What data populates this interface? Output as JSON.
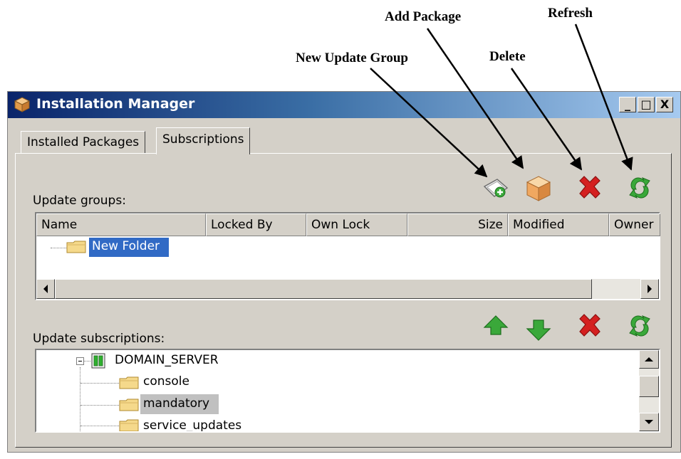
{
  "annotations": {
    "add_package": "Add Package",
    "refresh": "Refresh",
    "new_update_group": "New Update Group",
    "delete": "Delete"
  },
  "window": {
    "title": "Installation Manager",
    "controls": {
      "minimize": "_",
      "maximize": "□",
      "close": "X"
    }
  },
  "tabs": [
    {
      "label": "Installed Packages",
      "active": false
    },
    {
      "label": "Subscriptions",
      "active": true
    }
  ],
  "update_groups": {
    "label": "Update groups:",
    "toolbar": [
      "new-update-group-icon",
      "add-package-icon",
      "delete-icon",
      "refresh-icon"
    ],
    "columns": [
      "Name",
      "Locked By",
      "Own Lock",
      "Size",
      "Modified",
      "Owner"
    ],
    "rows": [
      {
        "name": "New Folder",
        "selected": true
      }
    ]
  },
  "update_subscriptions": {
    "label": "Update subscriptions:",
    "toolbar": [
      "move-up-icon",
      "move-down-icon",
      "delete-icon",
      "refresh-icon"
    ],
    "tree": {
      "root": "DOMAIN_SERVER",
      "children": [
        "console",
        "mandatory",
        "service_updates"
      ],
      "selected": "mandatory"
    }
  },
  "colors": {
    "window_face": "#d4d0c8",
    "titlebar_start": "#0a246a",
    "titlebar_end": "#a6caf0",
    "selection": "#316ac5",
    "inactive_selection": "#c0c0c0",
    "delete_red": "#d42020",
    "arrow_green": "#3aa83a"
  }
}
